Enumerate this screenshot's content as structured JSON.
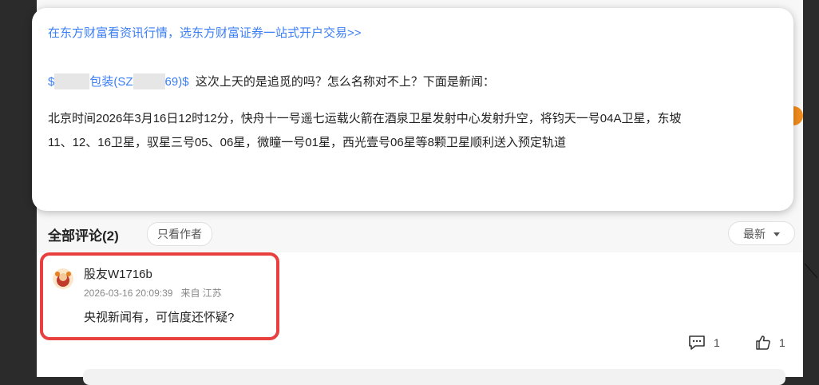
{
  "popup": {
    "promo_text": "在东方财富看资讯行情，选东方财富证券一站式开户交易>>",
    "stock_prefix": "$",
    "stock_name": "包装(SZ",
    "stock_suffix": "69)$",
    "question": "这次上天的是追觅的吗？怎么名称对不上？下面是新闻：",
    "body_line1": "北京时间2026年3月16日12时12分，快舟十一号遥七运载火箭在酒泉卫星发射中心发射升空，将钧天一号04A卫星，东坡",
    "body_line2": "11、12、16卫星，驭星三号05、06星，微瞳一号01星，西光壹号06星等8颗卫星顺利送入预定轨道"
  },
  "comments": {
    "title": "全部评论(2)",
    "author_only_label": "只看作者",
    "sort_label": "最新",
    "items": [
      {
        "username": "股友W1716b",
        "time": "2026-03-16 20:09:39",
        "location": "来自 江苏",
        "text": "央视新闻有，可信度还怀疑?",
        "reply_count": "1",
        "like_count": "1"
      }
    ]
  },
  "colors": {
    "link": "#3a7ef5",
    "highlight": "#e8403f",
    "accent_orange": "#f08c1e"
  },
  "icons": {
    "sort": "caret-down-icon",
    "reply": "comment-icon",
    "like": "thumbs-up-icon"
  }
}
